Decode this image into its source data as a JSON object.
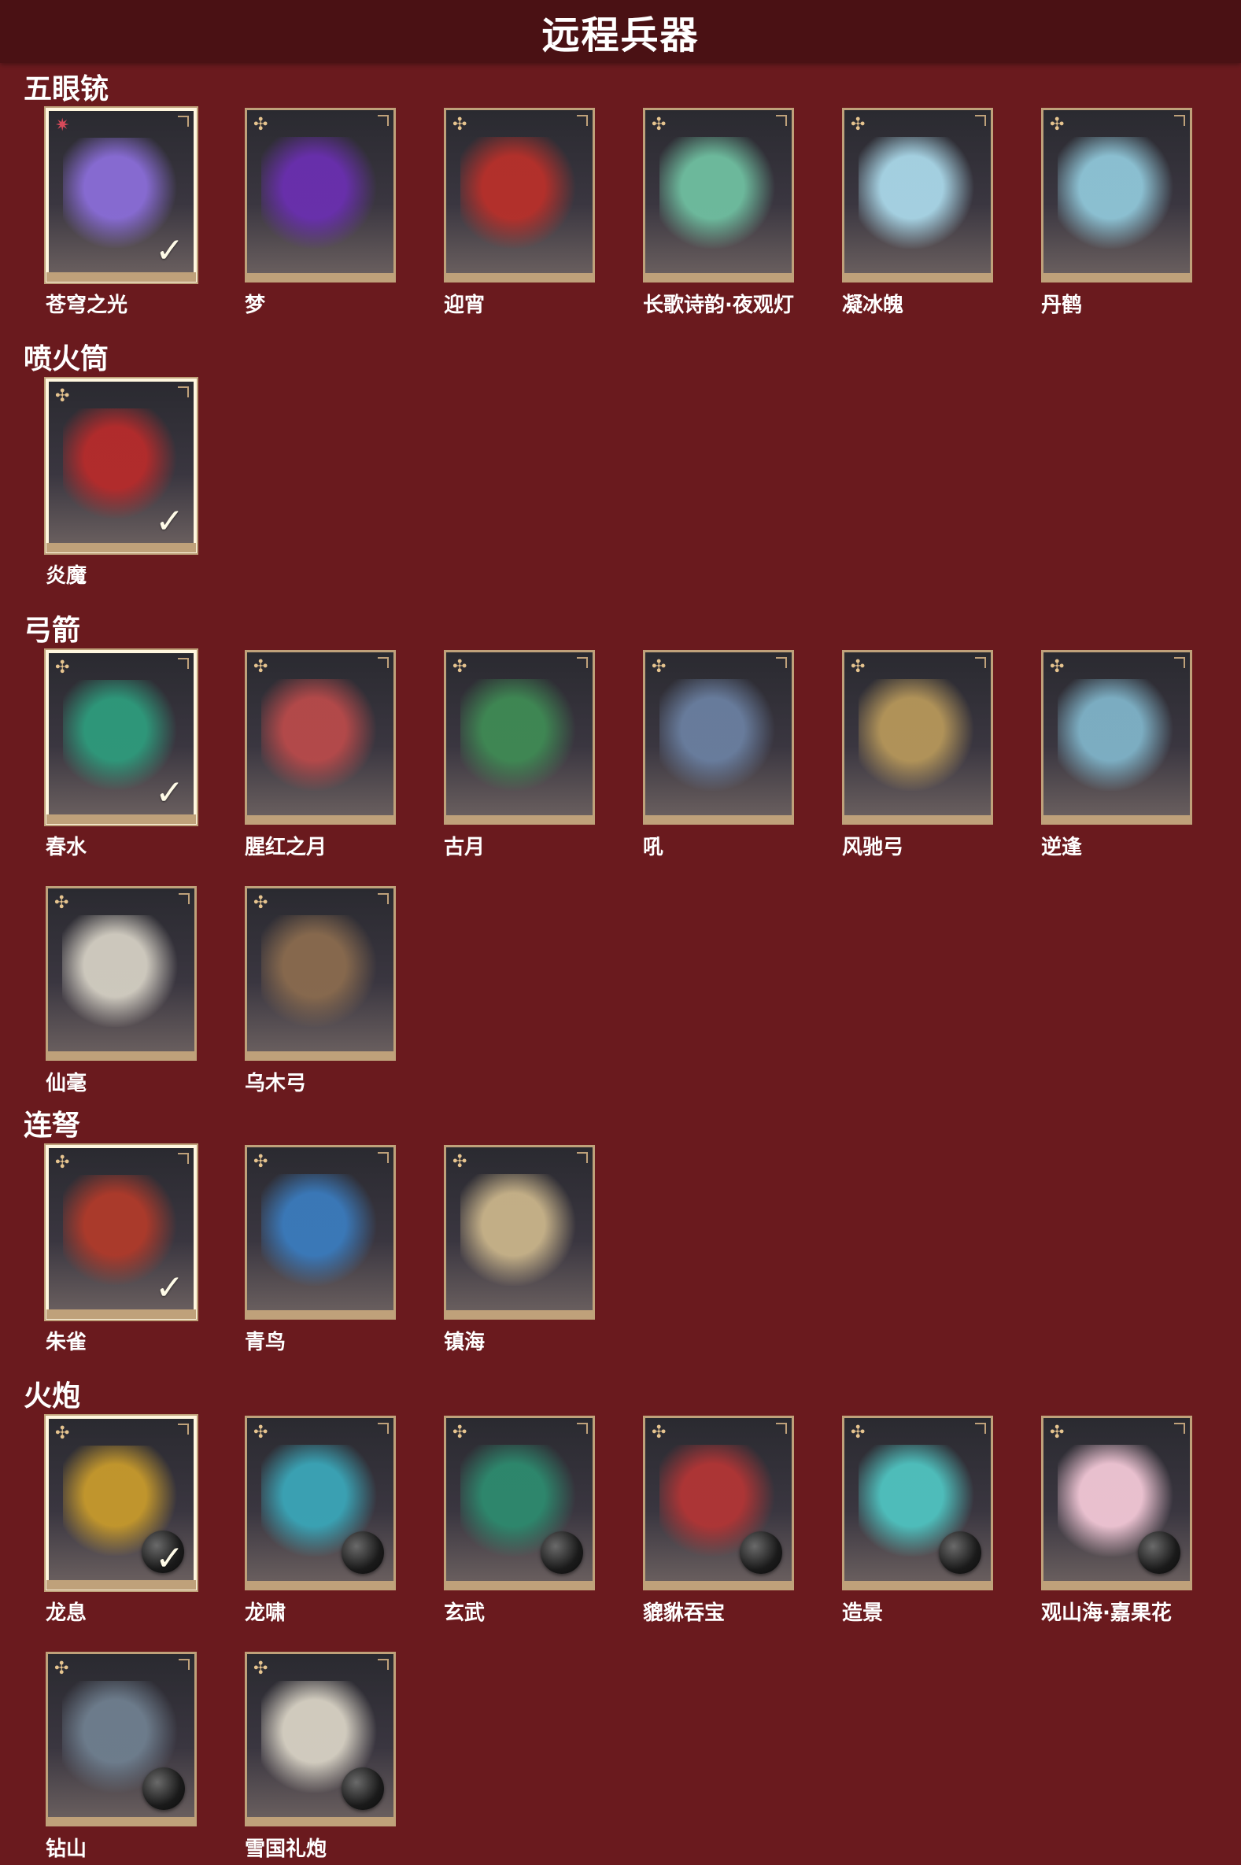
{
  "header": {
    "title": "远程兵器"
  },
  "colors": {
    "background": "#6a1a1e",
    "header_bg": "#4a1114",
    "card_border": "#bfa17a",
    "equipped_border": "#fff7df",
    "rarity_icon": "#e6c48f"
  },
  "sections": [
    {
      "title": "五眼铳",
      "items": [
        {
          "name": "苍穹之光",
          "icon": "sparkle-star-icon",
          "equipped": true,
          "ammo": false,
          "art": "#8a6dd8"
        },
        {
          "name": "梦",
          "icon": "rarity-icon",
          "equipped": false,
          "ammo": false,
          "art": "#6a2fb0"
        },
        {
          "name": "迎宵",
          "icon": "rarity-icon",
          "equipped": false,
          "ammo": false,
          "art": "#b8302a"
        },
        {
          "name": "长歌诗韵·夜观灯",
          "icon": "rarity-icon",
          "equipped": false,
          "ammo": false,
          "art": "#6fbfa0"
        },
        {
          "name": "凝冰魄",
          "icon": "rarity-icon",
          "equipped": false,
          "ammo": false,
          "art": "#a9d7e8"
        },
        {
          "name": "丹鹤",
          "icon": "rarity-icon",
          "equipped": false,
          "ammo": false,
          "art": "#8fc6d8"
        }
      ]
    },
    {
      "title": "喷火筒",
      "items": [
        {
          "name": "炎魔",
          "icon": "rarity-icon",
          "equipped": true,
          "ammo": false,
          "art": "#b72b2b"
        }
      ]
    },
    {
      "title": "弓箭",
      "items": [
        {
          "name": "春水",
          "icon": "rarity-icon",
          "equipped": true,
          "ammo": false,
          "art": "#2e9b7c"
        },
        {
          "name": "腥红之月",
          "icon": "rarity-icon",
          "equipped": false,
          "ammo": false,
          "art": "#b84a4a"
        },
        {
          "name": "古月",
          "icon": "rarity-icon",
          "equipped": false,
          "ammo": false,
          "art": "#3f8a54"
        },
        {
          "name": "吼",
          "icon": "rarity-icon",
          "equipped": false,
          "ammo": false,
          "art": "#6a7fa0"
        },
        {
          "name": "风驰弓",
          "icon": "rarity-icon",
          "equipped": false,
          "ammo": false,
          "art": "#b6975a"
        },
        {
          "name": "逆逢",
          "icon": "rarity-icon",
          "equipped": false,
          "ammo": false,
          "art": "#7fb3c8"
        },
        {
          "name": "仙毫",
          "icon": "rarity-icon",
          "equipped": false,
          "ammo": false,
          "art": "#d4cfc3"
        },
        {
          "name": "乌木弓",
          "icon": "rarity-icon",
          "equipped": false,
          "ammo": false,
          "art": "#8a6b4e"
        }
      ]
    },
    {
      "title": "连弩",
      "items": [
        {
          "name": "朱雀",
          "icon": "rarity-icon",
          "equipped": true,
          "ammo": false,
          "art": "#b03a2a"
        },
        {
          "name": "青鸟",
          "icon": "rarity-icon",
          "equipped": false,
          "ammo": false,
          "art": "#3a7bbd"
        },
        {
          "name": "镇海",
          "icon": "rarity-icon",
          "equipped": false,
          "ammo": false,
          "art": "#c9b48a"
        }
      ]
    },
    {
      "title": "火炮",
      "items": [
        {
          "name": "龙息",
          "icon": "rarity-icon",
          "equipped": true,
          "ammo": true,
          "art": "#c79a2c"
        },
        {
          "name": "龙啸",
          "icon": "rarity-icon",
          "equipped": false,
          "ammo": true,
          "art": "#3aa6b8"
        },
        {
          "name": "玄武",
          "icon": "rarity-icon",
          "equipped": false,
          "ammo": true,
          "art": "#2d8a6e"
        },
        {
          "name": "貔貅吞宝",
          "icon": "rarity-icon",
          "equipped": false,
          "ammo": true,
          "art": "#b23535"
        },
        {
          "name": "造景",
          "icon": "rarity-icon",
          "equipped": false,
          "ammo": true,
          "art": "#4fc3c0"
        },
        {
          "name": "观山海·嘉果花",
          "icon": "rarity-icon",
          "equipped": false,
          "ammo": true,
          "art": "#f2c7d6"
        },
        {
          "name": "钻山",
          "icon": "rarity-icon",
          "equipped": false,
          "ammo": true,
          "art": "#6f7f8f"
        },
        {
          "name": "雪国礼炮",
          "icon": "rarity-icon",
          "equipped": false,
          "ammo": true,
          "art": "#d8d2c4"
        }
      ]
    }
  ]
}
